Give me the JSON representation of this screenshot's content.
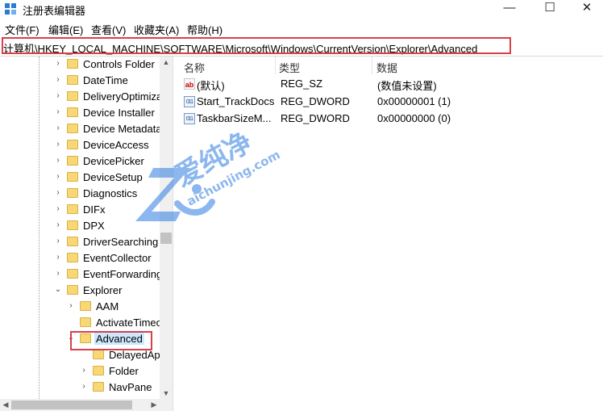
{
  "window": {
    "title": "注册表编辑器",
    "buttons": {
      "minimize": "—",
      "maximize": "☐",
      "close": "✕"
    }
  },
  "menu": [
    "文件(F)",
    "编辑(E)",
    "查看(V)",
    "收藏夹(A)",
    "帮助(H)"
  ],
  "address": "计算机\\HKEY_LOCAL_MACHINE\\SOFTWARE\\Microsoft\\Windows\\CurrentVersion\\Explorer\\Advanced",
  "tree": [
    {
      "label": "Controls Folder"
    },
    {
      "label": "DateTime"
    },
    {
      "label": "DeliveryOptimiza"
    },
    {
      "label": "Device Installer"
    },
    {
      "label": "Device Metadata"
    },
    {
      "label": "DeviceAccess"
    },
    {
      "label": "DevicePicker"
    },
    {
      "label": "DeviceSetup"
    },
    {
      "label": "Diagnostics"
    },
    {
      "label": "DIFx"
    },
    {
      "label": "DPX"
    },
    {
      "label": "DriverSearching"
    },
    {
      "label": "EventCollector"
    },
    {
      "label": "EventForwarding"
    },
    {
      "label": "Explorer"
    },
    {
      "label": "AAM"
    },
    {
      "label": "ActivateTimeo"
    },
    {
      "label": "Advanced"
    },
    {
      "label": "DelayedAp"
    },
    {
      "label": "Folder"
    },
    {
      "label": "NavPane"
    }
  ],
  "list": {
    "headers": {
      "name": "名称",
      "type": "类型",
      "data": "数据"
    },
    "rows": [
      {
        "icon": "string-value-icon",
        "name": "(默认)",
        "type": "REG_SZ",
        "data": "(数值未设置)"
      },
      {
        "icon": "binary-value-icon",
        "name": "Start_TrackDocs",
        "type": "REG_DWORD",
        "data": "0x00000001 (1)"
      },
      {
        "icon": "binary-value-icon",
        "name": "TaskbarSizeM...",
        "type": "REG_DWORD",
        "data": "0x00000000 (0)"
      }
    ]
  },
  "watermark": {
    "text": "爱纯净",
    "url": "aichunjing.com"
  },
  "colors": {
    "highlight_border": "#d9404a",
    "folder": "#f8d775",
    "selection": "#cce8ff"
  }
}
